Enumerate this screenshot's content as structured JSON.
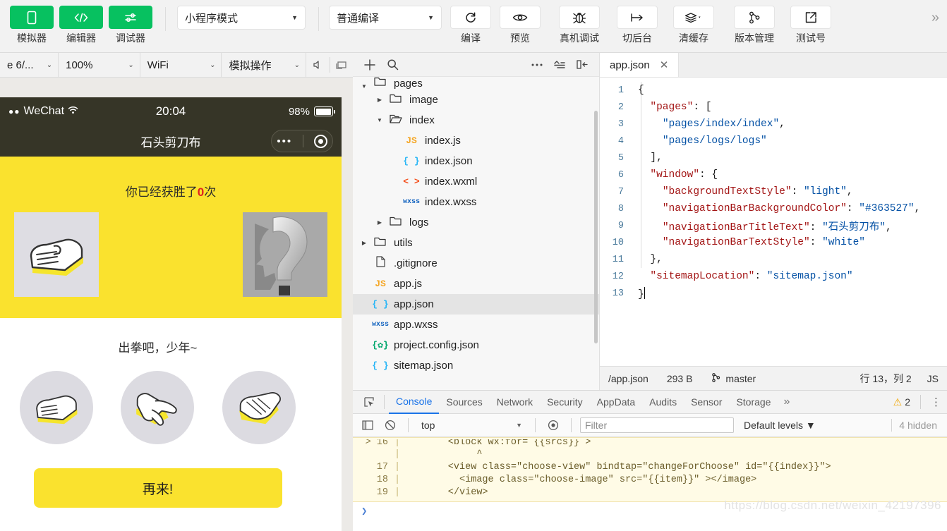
{
  "toolbar": {
    "items": [
      {
        "label": "模拟器",
        "icon": "phone-icon",
        "style": "green"
      },
      {
        "label": "编辑器",
        "icon": "code-icon",
        "style": "green"
      },
      {
        "label": "调试器",
        "icon": "sliders-icon",
        "style": "green"
      }
    ],
    "mode_select": {
      "value": "小程序模式",
      "caret": "▼"
    },
    "compile_select": {
      "value": "普通编译",
      "caret": "▼"
    },
    "actions": [
      {
        "label": "编译",
        "icon": "refresh-icon"
      },
      {
        "label": "预览",
        "icon": "eye-icon"
      },
      {
        "label": "真机调试",
        "icon": "bug-icon"
      },
      {
        "label": "切后台",
        "icon": "background-icon"
      },
      {
        "label": "清缓存",
        "icon": "layers-icon",
        "has_caret": true
      },
      {
        "label": "版本管理",
        "icon": "git-branch-icon"
      },
      {
        "label": "测试号",
        "icon": "external-link-icon"
      }
    ],
    "overflow": "»"
  },
  "simulator": {
    "toolbar": {
      "device": "e 6/...",
      "zoom": "100%",
      "network": "WiFi",
      "action": "模拟操作",
      "caret": "⌄",
      "icons": [
        "volume-icon",
        "rotate-screen-icon"
      ]
    },
    "phone": {
      "status_bar": {
        "carrier": "WeChat",
        "time": "20:04",
        "battery_percent": "98%"
      },
      "nav_title": "石头剪刀布",
      "win_prefix": "你已经获胜了",
      "win_count": "0",
      "win_suffix": "次",
      "prompt": "出拳吧，少年~",
      "again_button": "再来!"
    }
  },
  "file_tree": {
    "head_icons": [
      "add-icon",
      "search-icon",
      "more-icon",
      "collapse-icon",
      "hide-panel-icon"
    ],
    "rows": [
      {
        "label": "pages",
        "type": "folder",
        "arrow": "▼",
        "depth": 0,
        "partial": true
      },
      {
        "label": "image",
        "type": "folder",
        "arrow": "▶",
        "depth": 1
      },
      {
        "label": "index",
        "type": "folder-open",
        "arrow": "▼",
        "depth": 1
      },
      {
        "label": "index.js",
        "type": "js",
        "badge": "JS",
        "depth": 2
      },
      {
        "label": "index.json",
        "type": "json",
        "badge": "{ }",
        "depth": 2
      },
      {
        "label": "index.wxml",
        "type": "wxml",
        "badge": "< >",
        "depth": 2
      },
      {
        "label": "index.wxss",
        "type": "wxss",
        "badge": "wxss",
        "depth": 2
      },
      {
        "label": "logs",
        "type": "folder",
        "arrow": "▶",
        "depth": 1
      },
      {
        "label": "utils",
        "type": "folder",
        "arrow": "▶",
        "depth": 0
      },
      {
        "label": ".gitignore",
        "type": "plain",
        "badge": "🗋",
        "depth": 0
      },
      {
        "label": "app.js",
        "type": "js",
        "badge": "JS",
        "depth": 0
      },
      {
        "label": "app.json",
        "type": "json",
        "badge": "{ }",
        "depth": 0,
        "selected": true
      },
      {
        "label": "app.wxss",
        "type": "wxss",
        "badge": "wxss",
        "depth": 0
      },
      {
        "label": "project.config.json",
        "type": "cfg",
        "badge": "{✿}",
        "depth": 0
      },
      {
        "label": "sitemap.json",
        "type": "json",
        "badge": "{ }",
        "depth": 0
      }
    ]
  },
  "editor": {
    "tab": {
      "name": "app.json",
      "close": "✕"
    },
    "lines": [
      {
        "n": "1",
        "text": "{"
      },
      {
        "n": "2",
        "text": "  \"pages\": ["
      },
      {
        "n": "3",
        "text": "    \"pages/index/index\","
      },
      {
        "n": "4",
        "text": "    \"pages/logs/logs\""
      },
      {
        "n": "5",
        "text": "  ],"
      },
      {
        "n": "6",
        "text": "  \"window\": {"
      },
      {
        "n": "7",
        "text": "    \"backgroundTextStyle\": \"light\","
      },
      {
        "n": "8",
        "text": "    \"navigationBarBackgroundColor\": \"#363527\","
      },
      {
        "n": "9",
        "text": "    \"navigationBarTitleText\": \"石头剪刀布\","
      },
      {
        "n": "10",
        "text": "    \"navigationBarTextStyle\": \"white\""
      },
      {
        "n": "11",
        "text": "  },"
      },
      {
        "n": "12",
        "text": "  \"sitemapLocation\": \"sitemap.json\""
      },
      {
        "n": "13",
        "text": "}"
      }
    ],
    "status": {
      "path": "/app.json",
      "size": "293 B",
      "branch": "master",
      "branch_icon": "git-branch-icon",
      "cursor": "行 13，列 2",
      "language": "JS"
    }
  },
  "devtools": {
    "inspect_icon": "inspect-element-icon",
    "tabs": [
      {
        "label": "Console",
        "active": true
      },
      {
        "label": "Sources",
        "active": false
      },
      {
        "label": "Network",
        "active": false
      },
      {
        "label": "Security",
        "active": false
      },
      {
        "label": "AppData",
        "active": false
      },
      {
        "label": "Audits",
        "active": false
      },
      {
        "label": "Sensor",
        "active": false
      },
      {
        "label": "Storage",
        "active": false
      }
    ],
    "overflow": "»",
    "warning_icon": "warning-triangle-icon",
    "warning_count": "2",
    "kebab": "⋮",
    "filters": {
      "sidebar_icon": "console-sidebar-icon",
      "clear_icon": "clear-console-icon",
      "context": "top",
      "context_caret": "▼",
      "eye_icon": "live-expression-icon",
      "filter_placeholder": "Filter",
      "filter_value": "",
      "levels": "Default levels ▼",
      "hidden": "4 hidden"
    },
    "warning_lines": [
      {
        "gutter": "> 16",
        "bar": "|",
        "code": "        <block wx:for= {{srcs}} >"
      },
      {
        "gutter": "",
        "bar": "|",
        "code": "             ^"
      },
      {
        "gutter": "17",
        "bar": "|",
        "code": "        <view class=\"choose-view\" bindtap=\"changeForChoose\" id=\"{{index}}\">"
      },
      {
        "gutter": "18",
        "bar": "|",
        "code": "          <image class=\"choose-image\" src=\"{{item}}\" ></image>"
      },
      {
        "gutter": "19",
        "bar": "|",
        "code": "        </view>"
      }
    ],
    "prompt_chevron": "❯",
    "watermark": "https://blog.csdn.net/weixin_42197396"
  },
  "colors": {
    "brand_green": "#07c160",
    "nav_bar": "#363527",
    "page_yellow": "#FAE22E",
    "accent_blue": "#1a73e8",
    "warn_yellow": "#f2a600"
  }
}
